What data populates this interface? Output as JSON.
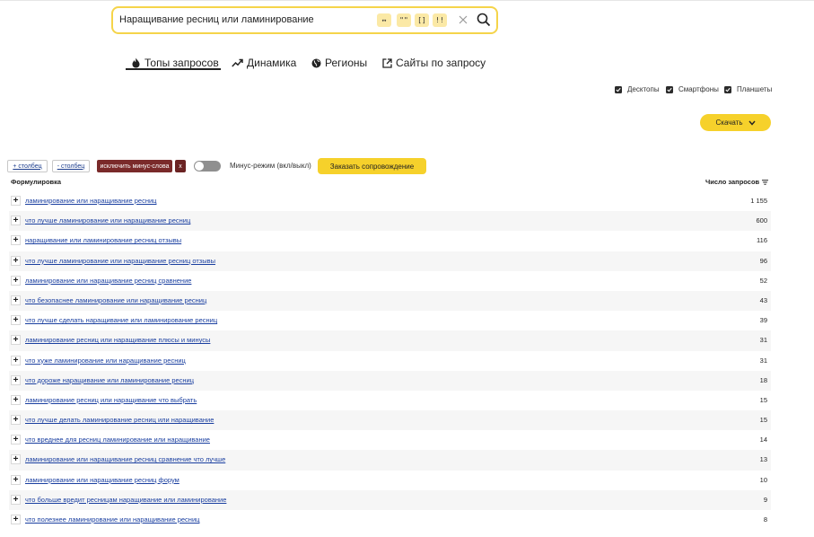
{
  "search": {
    "query": "Наращивание ресниц или ламинирование",
    "operators": [
      "+↔",
      "\"\"",
      "[]",
      "!!"
    ],
    "operator_labels": [
      "↔",
      "\"\"",
      "[]",
      "!!"
    ]
  },
  "tabs": [
    {
      "label": "Топы запросов",
      "icon": "fire-icon",
      "active": true
    },
    {
      "label": "Динамика",
      "icon": "trend-icon",
      "active": false
    },
    {
      "label": "Регионы",
      "icon": "globe-icon",
      "active": false
    },
    {
      "label": "Сайты по запросу",
      "icon": "external-link-icon",
      "active": false
    }
  ],
  "devices": [
    {
      "label": "Десктопы",
      "checked": true
    },
    {
      "label": "Смартфоны",
      "checked": true
    },
    {
      "label": "Планшеты",
      "checked": true
    }
  ],
  "download_label": "Скачать",
  "toolbar": {
    "add_column": "+ столбец",
    "remove_column": "- столбец",
    "exclude_minus": "исключить минус-слова",
    "exclude_x": "x",
    "minus_mode": "Минус-режим (вкл/выкл)",
    "order_support": "Заказать сопровождение"
  },
  "table": {
    "col_phrase": "Формулировка",
    "col_count": "Число запросов",
    "rows": [
      {
        "phrase": "ламинирование или наращивание ресниц",
        "count": "1 155"
      },
      {
        "phrase": "что лучше ламинирование или наращивание ресниц",
        "count": "600"
      },
      {
        "phrase": "наращивание или ламинирование ресниц отзывы",
        "count": "116"
      },
      {
        "phrase": "что лучше ламинирование или наращивание ресниц отзывы",
        "count": "96"
      },
      {
        "phrase": "ламинирование или наращивание ресниц сравнение",
        "count": "52"
      },
      {
        "phrase": "что безопаснее ламинирование или наращивание ресниц",
        "count": "43"
      },
      {
        "phrase": "что лучше сделать наращивание или ламинирование ресниц",
        "count": "39"
      },
      {
        "phrase": "ламинирование ресниц или наращивание плюсы и минусы",
        "count": "31"
      },
      {
        "phrase": "что хуже ламинирование или наращивание ресниц",
        "count": "31"
      },
      {
        "phrase": "что дороже наращивание или ламинирование ресниц",
        "count": "18"
      },
      {
        "phrase": "ламинирование ресниц или наращивание что выбрать",
        "count": "15"
      },
      {
        "phrase": "что лучше делать ламинирование ресниц или наращивание",
        "count": "15"
      },
      {
        "phrase": "что вреднее для ресниц ламинирование или наращивание",
        "count": "14"
      },
      {
        "phrase": "ламинирование или наращивание ресниц сравнение что лучше",
        "count": "13"
      },
      {
        "phrase": "ламинирование или наращивание ресниц форум",
        "count": "10"
      },
      {
        "phrase": "что больше вредит ресницам наращивание или ламинирование",
        "count": "9"
      },
      {
        "phrase": "что полезнее ламинирование или наращивание ресниц",
        "count": "8"
      }
    ]
  },
  "colors": {
    "accent_yellow": "#f6d12b",
    "search_border": "#f5d44a",
    "link_blue": "#1a3fa0",
    "minus_button": "#7a2a2a"
  }
}
